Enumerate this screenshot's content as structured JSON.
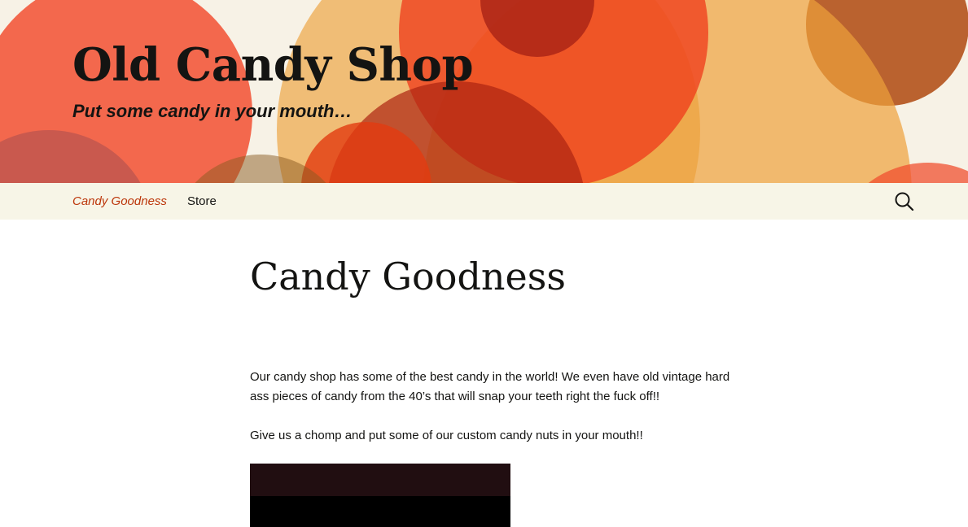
{
  "site": {
    "title": "Old Candy Shop",
    "tagline": "Put some candy in your mouth…"
  },
  "nav": {
    "items": [
      {
        "label": "Candy Goodness",
        "active": true
      },
      {
        "label": "Store",
        "active": false
      }
    ],
    "search_icon": "search-icon"
  },
  "page": {
    "title": "Candy Goodness",
    "paragraphs": [
      "Our candy shop has some of the best candy in the world! We even have old vintage hard ass pieces of candy from the 40’s that will snap your teeth right the fuck off!!",
      "Give us a chomp and put some of our custom candy nuts in your mouth!!"
    ]
  },
  "colors": {
    "accent": "#bc360a",
    "nav_bg": "#f7f5e7",
    "header_bg": "#f7f2e6",
    "text": "#141412"
  }
}
